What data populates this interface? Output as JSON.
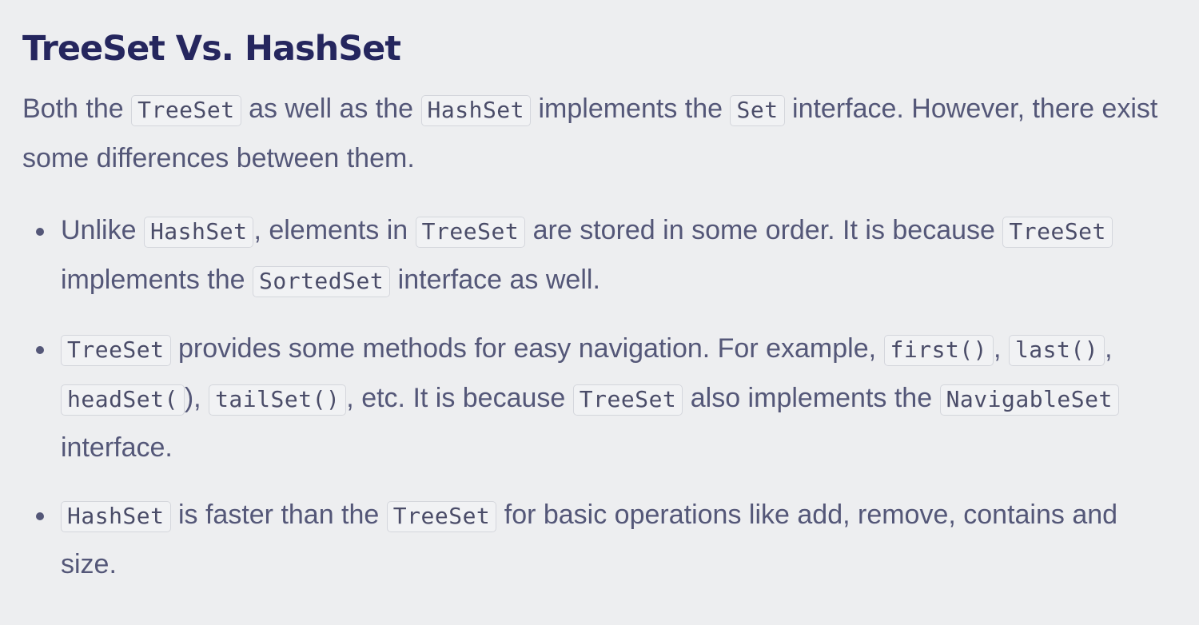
{
  "title": "TreeSet Vs. HashSet",
  "intro": {
    "t1": "Both the ",
    "c1": "TreeSet",
    "t2": " as well as the ",
    "c2": "HashSet",
    "t3": " implements the ",
    "c3": "Set",
    "t4": " interface. However, there exist some differences between them."
  },
  "bullets": [
    {
      "t1": "Unlike ",
      "c1": "HashSet",
      "t2": ", elements in ",
      "c2": "TreeSet",
      "t3": " are stored in some order. It is because ",
      "c3": "TreeSet",
      "t4": " implements the ",
      "c4": "SortedSet",
      "t5": " interface as well."
    },
    {
      "c1": "TreeSet",
      "t1": " provides some methods for easy navigation. For example, ",
      "c2": "first()",
      "t2": ", ",
      "c3": "last()",
      "t3": ", ",
      "c4": "headSet(",
      "t4": "), ",
      "c5": "tailSet()",
      "t5": ", etc. It is because ",
      "c6": "TreeSet",
      "t6": " also implements the ",
      "c7": "NavigableSet",
      "t7": " interface."
    },
    {
      "c1": "HashSet",
      "t1": " is faster than the ",
      "c2": "TreeSet",
      "t2": " for basic operations like add, remove, contains and size."
    }
  ]
}
